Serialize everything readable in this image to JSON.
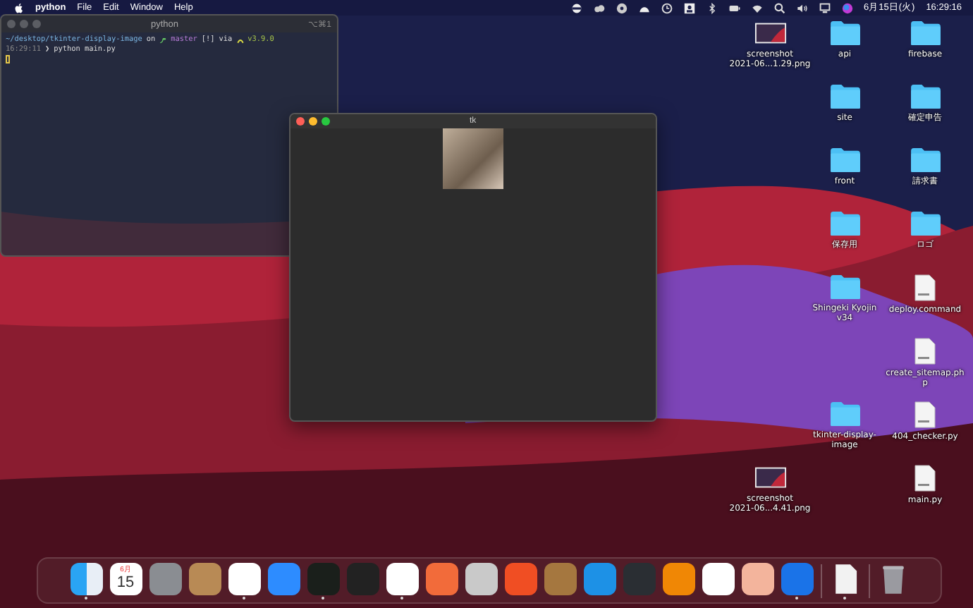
{
  "menu_bar": {
    "app_name": "python",
    "menus": [
      "File",
      "Edit",
      "Window",
      "Help"
    ],
    "date": "6月15日(火)",
    "time": "16:29:16"
  },
  "terminal_window": {
    "title": "python",
    "shortcut": "⌥⌘1",
    "prompt": {
      "path": "~/desktop/tkinter-display-image",
      "on": "on",
      "branch": "master",
      "status": "[!]",
      "via": "via",
      "version": "v3.9.0"
    },
    "command_line": {
      "time": "16:29:11",
      "arrow": "❯",
      "command": "python main.py"
    }
  },
  "tk_window": {
    "title": "tk"
  },
  "desktop_icons": [
    {
      "kind": "image",
      "label": "screenshot\n2021-06...1.29.png"
    },
    {
      "kind": "folder",
      "label": "api"
    },
    {
      "kind": "folder",
      "label": "firebase"
    },
    {
      "kind": "folder",
      "label": "site"
    },
    {
      "kind": "folder",
      "label": "確定申告"
    },
    {
      "kind": "folder",
      "label": "front"
    },
    {
      "kind": "folder",
      "label": "請求書"
    },
    {
      "kind": "folder",
      "label": "保存用"
    },
    {
      "kind": "folder",
      "label": "ロゴ"
    },
    {
      "kind": "folder",
      "label": "Shingeki Kyojin\nv34"
    },
    {
      "kind": "file",
      "label": "deploy.command"
    },
    {
      "kind": "file",
      "label": "create_sitemap.ph\np"
    },
    {
      "kind": "folder",
      "label": "tkinter-display-\nimage"
    },
    {
      "kind": "file",
      "label": "404_checker.py"
    },
    {
      "kind": "image",
      "label": "screenshot\n2021-06...4.41.png"
    },
    {
      "kind": "file",
      "label": "main.py"
    }
  ],
  "calendar_icon": {
    "month": "6月",
    "day": "15"
  },
  "dock": [
    {
      "kind": "app",
      "running": true
    },
    {
      "kind": "calendar",
      "running": false
    },
    {
      "kind": "app",
      "running": false
    },
    {
      "kind": "app",
      "running": false
    },
    {
      "kind": "app",
      "running": true
    },
    {
      "kind": "app",
      "running": false
    },
    {
      "kind": "app",
      "running": true
    },
    {
      "kind": "app",
      "running": false
    },
    {
      "kind": "app",
      "running": true
    },
    {
      "kind": "app",
      "running": false
    },
    {
      "kind": "app",
      "running": false
    },
    {
      "kind": "app",
      "running": false
    },
    {
      "kind": "app",
      "running": false
    },
    {
      "kind": "app",
      "running": false
    },
    {
      "kind": "app",
      "running": false
    },
    {
      "kind": "app",
      "running": false
    },
    {
      "kind": "app",
      "running": false
    },
    {
      "kind": "app",
      "running": false
    },
    {
      "kind": "app",
      "running": true
    },
    {
      "kind": "file",
      "running": true
    },
    {
      "kind": "trash",
      "running": false
    }
  ]
}
